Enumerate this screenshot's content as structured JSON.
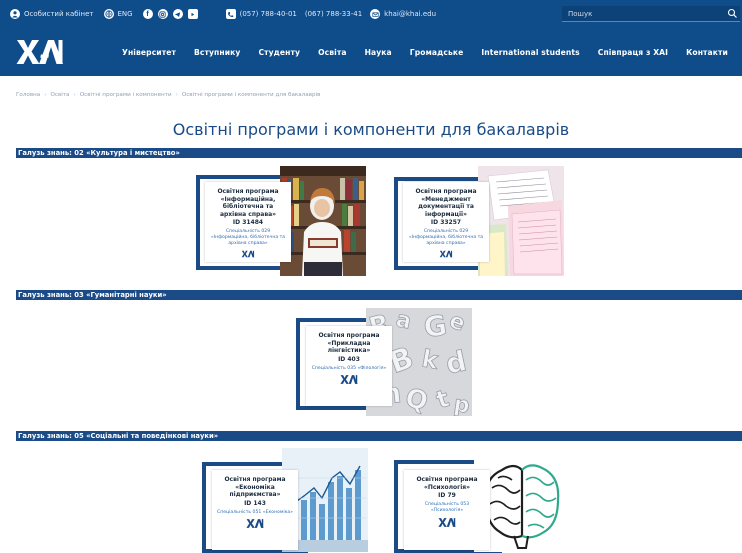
{
  "topbar": {
    "cabinet_label": "Особистий кабінет",
    "lang_label": "ENG",
    "social_icons": [
      "facebook-icon",
      "instagram-icon",
      "telegram-icon",
      "youtube-icon"
    ],
    "phones": [
      "(057) 788-40-01",
      "(067) 788-33-41"
    ],
    "email": "khai@khai.edu",
    "search_placeholder": "Пошук"
  },
  "nav": {
    "items": [
      "Університет",
      "Вступнику",
      "Студенту",
      "Освіта",
      "Наука",
      "Громадське",
      "International students",
      "Співпраця з ХАІ",
      "Контакти"
    ]
  },
  "breadcrumb": [
    "Головна",
    "Освіта",
    "Освітні програми і компоненти",
    "Освітні програми і компоненти для бакалаврів"
  ],
  "page_title": "Освітні програми і компоненти для бакалаврів",
  "sections": [
    {
      "header": "Галузь знань: 02 «Культура і мистецтво»",
      "cards": [
        {
          "title": "Освітня програма «Інформаційна, бібліотечна та архівна справа»",
          "code": "ID 31484",
          "sub": "Спеціальність 029 «Інформаційна, бібліотечна та архівна справа»",
          "photo": "library"
        },
        {
          "title": "Освітня програма «Менеджмент документації та інформації»",
          "code": "ID 33257",
          "sub": "Спеціальність 029 «Інформаційна, бібліотечна та архівна справа»",
          "photo": "documents"
        }
      ]
    },
    {
      "header": "Галузь знань: 03 «Гуманітарні науки»",
      "cards": [
        {
          "title": "Освітня програма «Прикладна лінгвістика»",
          "code": "ID 403",
          "sub": "Спеціальність 035 «Філологія»",
          "photo": "letters"
        }
      ]
    },
    {
      "header": "Галузь знань: 05 «Соціальні та поведінкові науки»",
      "cards": [
        {
          "title": "Освітня програма «Економіка підприємства»",
          "code": "ID 143",
          "sub": "Спеціальність 051 «Економіка»",
          "photo": "chart"
        },
        {
          "title": "Освітня програма «Психологія»",
          "code": "ID 79",
          "sub": "Спеціальність 053 «Психологія»",
          "photo": "brain"
        }
      ]
    }
  ],
  "colors": {
    "brand_blue": "#0e4c8a",
    "section_blue": "#1a4b86",
    "text_blue": "#2f6db1"
  }
}
